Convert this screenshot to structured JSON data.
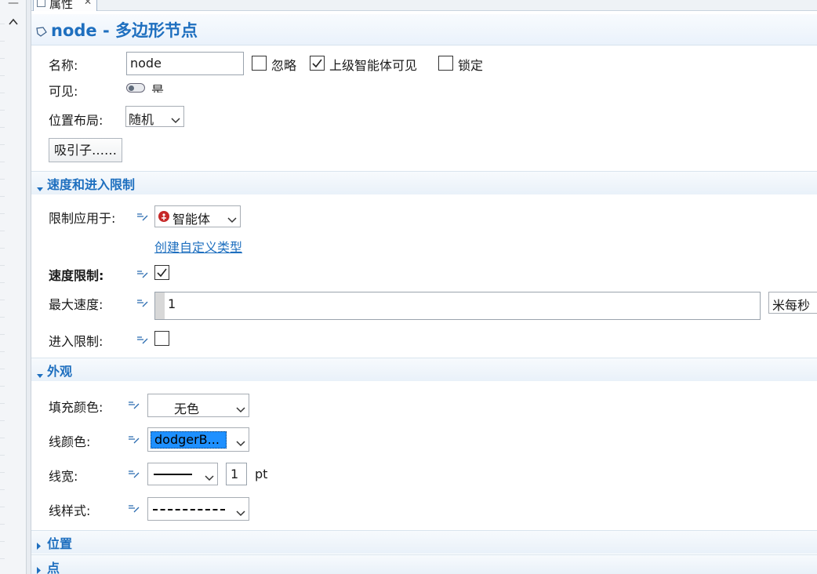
{
  "tab": {
    "label": "属性"
  },
  "header": {
    "title": "node - 多边形节点"
  },
  "general": {
    "name_label": "名称:",
    "name_value": "node",
    "ignore_label": "忽略",
    "ignore_checked": false,
    "upper_visible_label": "上级智能体可见",
    "upper_visible_checked": true,
    "lock_label": "锁定",
    "lock_checked": false,
    "visible_label": "可见:",
    "visible_value": "是",
    "layout_label": "位置布局:",
    "layout_value": "随机",
    "attractors_button": "吸引子……"
  },
  "speed_section": {
    "title": "速度和进入限制",
    "apply_to_label": "限制应用于:",
    "apply_to_value": "智能体",
    "create_type_link": "创建自定义类型",
    "speed_limit_label": "速度限制:",
    "speed_limit_checked": true,
    "max_speed_label": "最大速度:",
    "max_speed_value": "1",
    "max_speed_unit": "米每秒",
    "entry_limit_label": "进入限制:",
    "entry_limit_checked": false
  },
  "appearance_section": {
    "title": "外观",
    "fill_color_label": "填充颜色:",
    "fill_color_value": "无色",
    "line_color_label": "线颜色:",
    "line_color_value": "dodgerB...",
    "line_color_swatch": "#1e90ff",
    "line_width_label": "线宽:",
    "line_width_value": "1",
    "line_width_unit": "pt",
    "line_style_label": "线样式:"
  },
  "position_section": {
    "title": "位置"
  },
  "points_section": {
    "title": "点"
  },
  "colors": {
    "accent": "#1e6fbf",
    "selection": "#1e90ff"
  }
}
